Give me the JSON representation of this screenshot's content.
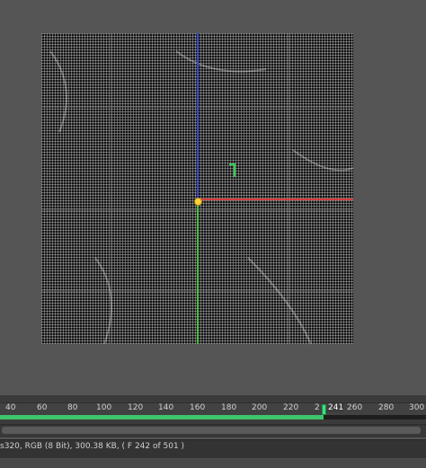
{
  "viewport": {
    "frame_label": "render-frame"
  },
  "colors": {
    "axis_x": "#d83a3a",
    "axis_y": "#3fc03f",
    "axis_z": "#3a48c8",
    "playhead": "#3ee082",
    "timeline_fill": "#3ec46a"
  },
  "timeline": {
    "ticks": [
      "40",
      "60",
      "80",
      "100",
      "120",
      "140",
      "160",
      "180",
      "200",
      "220",
      "2",
      "241",
      "260",
      "280",
      "300"
    ],
    "current_frame": "241",
    "progress": 0.76
  },
  "status": {
    "text": "s320, RGB (8 Bit), 300.38 KB, ( F 242 of 501 )"
  }
}
